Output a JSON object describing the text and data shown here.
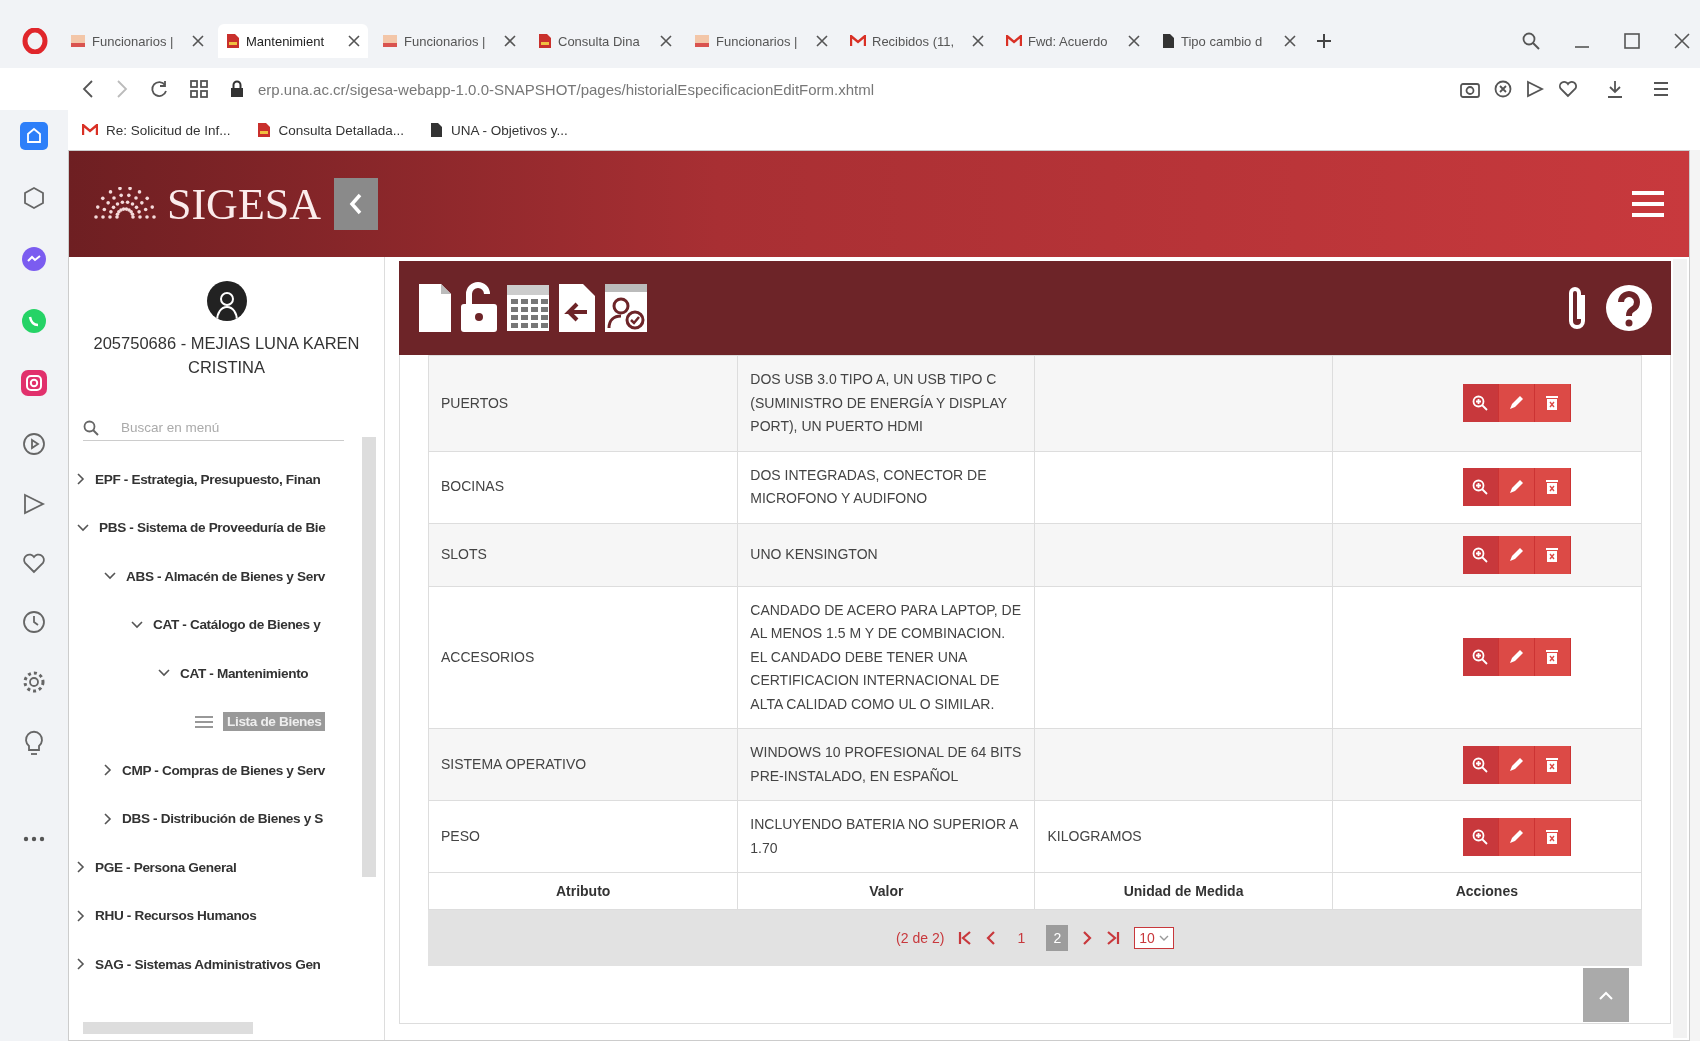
{
  "browser": {
    "tabs": [
      {
        "kind": "una",
        "title": "Funcionarios |",
        "selected": false
      },
      {
        "kind": "doc-red",
        "title": "Mantenimient",
        "selected": true
      },
      {
        "kind": "una",
        "title": "Funcionarios |",
        "selected": false
      },
      {
        "kind": "doc-red",
        "title": "Consulta Dina",
        "selected": false
      },
      {
        "kind": "una",
        "title": "Funcionarios |",
        "selected": false
      },
      {
        "kind": "gmail",
        "title": "Recibidos (11,",
        "selected": false
      },
      {
        "kind": "gmail",
        "title": "Fwd: Acuerdo",
        "selected": false
      },
      {
        "kind": "doc",
        "title": "Tipo cambio d",
        "selected": false
      }
    ],
    "address": "erp.una.ac.cr/sigesa-webapp-1.0.0-SNAPSHOT/pages/historialEspecificacionEditForm.xhtml",
    "bookmarks": [
      {
        "kind": "gmail",
        "label": "Re: Solicitud de Inf..."
      },
      {
        "kind": "doc-red",
        "label": "Consulta Detallada..."
      },
      {
        "kind": "doc",
        "label": "UNA - Objetivos y..."
      }
    ]
  },
  "app": {
    "logo": "SIGESA",
    "user": "205750686 - MEJIAS LUNA KAREN CRISTINA",
    "menu_search": {
      "placeholder": "Buscar en menú"
    },
    "menu": [
      {
        "kind": "folder",
        "label": "EPF - Estrategia, Presupuesto, Finan",
        "expanded": false,
        "selected": false
      },
      {
        "kind": "folder",
        "label": "PBS - Sistema de Proveeduría de Bie",
        "expanded": true,
        "selected": false,
        "children": [
          {
            "kind": "folder",
            "label": "ABS - Almacén de Bienes y Serv",
            "expanded": true,
            "selected": false,
            "children": [
              {
                "kind": "folder",
                "label": "CAT - Catálogo de Bienes y",
                "expanded": true,
                "selected": false,
                "children": [
                  {
                    "kind": "folder",
                    "label": "CAT - Mantenimiento",
                    "expanded": true,
                    "selected": false,
                    "children": [
                      {
                        "kind": "page",
                        "label": "Lista de Bienes",
                        "selected": true
                      }
                    ]
                  }
                ]
              }
            ]
          },
          {
            "kind": "folder",
            "label": "CMP - Compras de Bienes y Serv",
            "expanded": false,
            "selected": false
          },
          {
            "kind": "folder",
            "label": "DBS - Distribución de Bienes y S",
            "expanded": false,
            "selected": false
          }
        ]
      },
      {
        "kind": "folder",
        "label": "PGE - Persona General",
        "expanded": false,
        "selected": false
      },
      {
        "kind": "folder",
        "label": "RHU - Recursos Humanos",
        "expanded": false,
        "selected": false
      },
      {
        "kind": "folder",
        "label": "SAG - Sistemas Administrativos Gen",
        "expanded": false,
        "selected": false
      }
    ],
    "table": {
      "columns": [
        "Atributo",
        "Valor",
        "Unidad de Medida",
        "Acciones"
      ],
      "rows": [
        {
          "atributo": "PUERTOS",
          "valor": "DOS USB 3.0 TIPO A, UN USB TIPO C (SUMINISTRO DE ENERGÍA Y DISPLAY PORT), UN PUERTO HDMI"
        },
        {
          "atributo": "BOCINAS",
          "valor": "DOS INTEGRADAS, CONECTOR DE MICROFONO Y AUDIFONO"
        },
        {
          "atributo": "SLOTS",
          "valor": "UNO KENSINGTON"
        },
        {
          "atributo": "ACCESORIOS",
          "valor": "CANDADO DE ACERO PARA LAPTOP, DE AL MENOS 1.5 M Y DE COMBINACION. EL CANDADO DEBE TENER UNA CERTIFICACION INTERNACIONAL DE ALTA CALIDAD COMO UL O SIMILAR."
        },
        {
          "atributo": "SISTEMA OPERATIVO",
          "valor": "WINDOWS 10 PROFESIONAL DE 64 BITS PRE-INSTALADO, EN ESPAÑOL"
        },
        {
          "atributo": "PESO",
          "valor": "INCLUYENDO BATERIA NO SUPERIOR A 1.70",
          "unidad": "KILOGRAMOS"
        }
      ],
      "paginator": {
        "summary": "(2 de 2)",
        "pages": [
          {
            "label": "1",
            "selected": false
          },
          {
            "label": "2",
            "selected": true
          }
        ],
        "rows_per_page": "10"
      }
    }
  }
}
